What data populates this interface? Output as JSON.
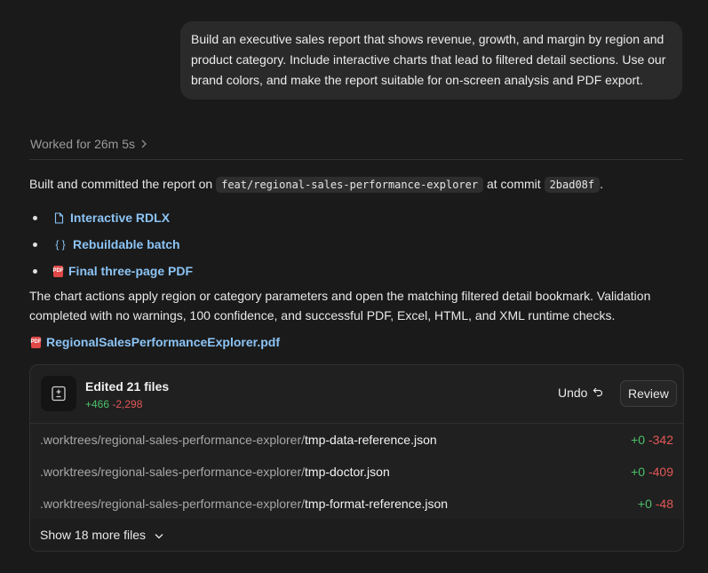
{
  "user_message": "Build an executive sales report that shows revenue, growth, and margin by region and product category. Include interactive charts that lead to filtered detail sections. Use our brand colors, and make the report suitable for on-screen analysis and PDF export.",
  "worked": {
    "label": "Worked for 26m 5s"
  },
  "summary": {
    "prefix": "Built and committed the report on ",
    "branch": "feat/regional-sales-performance-explorer",
    "middle": " at commit ",
    "commit": "2bad08f",
    "suffix": "."
  },
  "links": [
    {
      "label": "Interactive RDLX",
      "icon": "file-icon"
    },
    {
      "label": "Rebuildable batch",
      "icon": "braces-icon"
    },
    {
      "label": "Final three-page PDF",
      "icon": "pdf-icon"
    }
  ],
  "paragraph": "The chart actions apply region or category parameters and open the matching filtered detail bookmark. Validation completed with no warnings, 100 confidence, and successful PDF, Excel, HTML, and XML runtime checks.",
  "pdf_link": {
    "label": "RegionalSalesPerformanceExplorer.pdf"
  },
  "changes": {
    "title": "Edited 21 files",
    "added": "+466",
    "removed": "-2,298",
    "undo_label": "Undo",
    "review_label": "Review",
    "files": [
      {
        "dir": ".worktrees/regional-sales-performance-explorer/",
        "name": "tmp-data-reference.json",
        "added": "+0",
        "removed": "-342"
      },
      {
        "dir": ".worktrees/regional-sales-performance-explorer/",
        "name": "tmp-doctor.json",
        "added": "+0",
        "removed": "-409"
      },
      {
        "dir": ".worktrees/regional-sales-performance-explorer/",
        "name": "tmp-format-reference.json",
        "added": "+0",
        "removed": "-48"
      }
    ],
    "show_more_label": "Show 18 more files"
  },
  "colors": {
    "link": "#8cc4f5",
    "added": "#4cc06b",
    "removed": "#e45656",
    "background": "#1a1a1a"
  }
}
